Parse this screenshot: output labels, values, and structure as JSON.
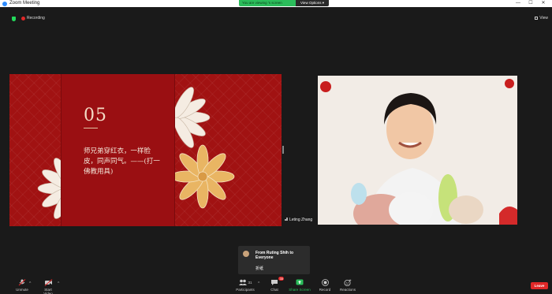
{
  "window": {
    "title": "Zoom Meeting",
    "controls": [
      "—",
      "☐",
      "✕"
    ]
  },
  "banner": {
    "viewing_text": "You are viewing  's screen",
    "view_options": "View Options ▾"
  },
  "meeting": {
    "recording_label": "Recording",
    "view_label": "View"
  },
  "slide": {
    "number": "05",
    "riddle": "师兄弟穿红衣，一样脸皮，同声同气。——(打一佛教用具)"
  },
  "video": {
    "participant_name": "Leting Zhang"
  },
  "chat_toast": {
    "from": "From Ruting Shih to Everyone",
    "message": "折纸"
  },
  "toolbar": {
    "unmute": "Unmute",
    "start_video": "Start Video",
    "participants": "Participants",
    "participants_count": "31",
    "chat": "Chat",
    "chat_badge": "35",
    "share_screen": "Share Screen",
    "record": "Record",
    "reactions": "Reactions",
    "leave": "Leave"
  },
  "colors": {
    "slide_red": "#a11212",
    "accent_green": "#2bbd5b",
    "leave_red": "#e02828"
  }
}
